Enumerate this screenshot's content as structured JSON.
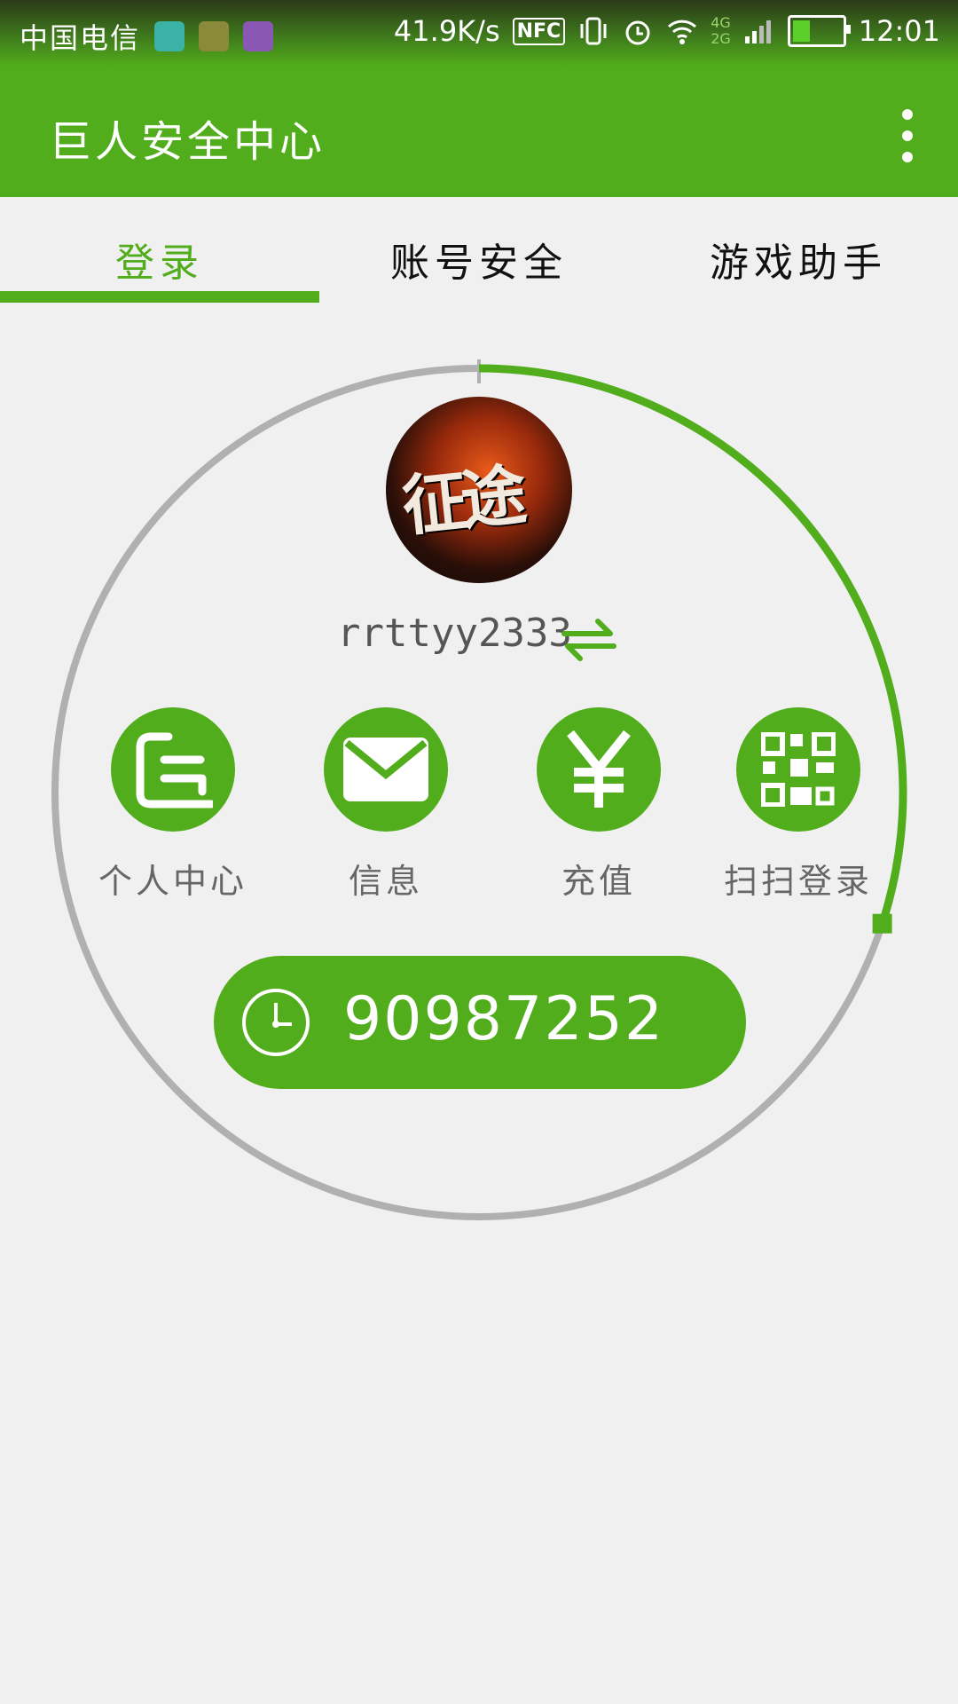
{
  "status_bar": {
    "carrier": "中国电信",
    "net_speed": "41.9K/s",
    "nfc": "NFC",
    "net_type_top": "4G",
    "net_type_bottom": "2G",
    "battery_level": 0.35,
    "time": "12:01",
    "notification_icons": [
      "android-debug-icon",
      "chat-bubble-icon",
      "gallery-icon"
    ]
  },
  "app_bar": {
    "title": "巨人安全中心",
    "menu_icon": "more-vert-icon"
  },
  "tabs": [
    {
      "label": "登录",
      "active": true
    },
    {
      "label": "账号安全",
      "active": false
    },
    {
      "label": "游戏助手",
      "active": false
    }
  ],
  "login": {
    "countdown_progress": 0.3,
    "avatar_text": "征途",
    "username": "rrttyy2333",
    "actions": [
      {
        "label": "个人中心",
        "icon": "profile-icon"
      },
      {
        "label": "信息",
        "icon": "mail-icon"
      },
      {
        "label": "充值",
        "icon": "yuan-icon"
      },
      {
        "label": "扫扫登录",
        "icon": "qr-code-icon"
      }
    ],
    "token": "90987252"
  },
  "colors": {
    "accent": "#52ad1c",
    "ring": "#b0b0b0",
    "background": "#f0f0f1"
  }
}
